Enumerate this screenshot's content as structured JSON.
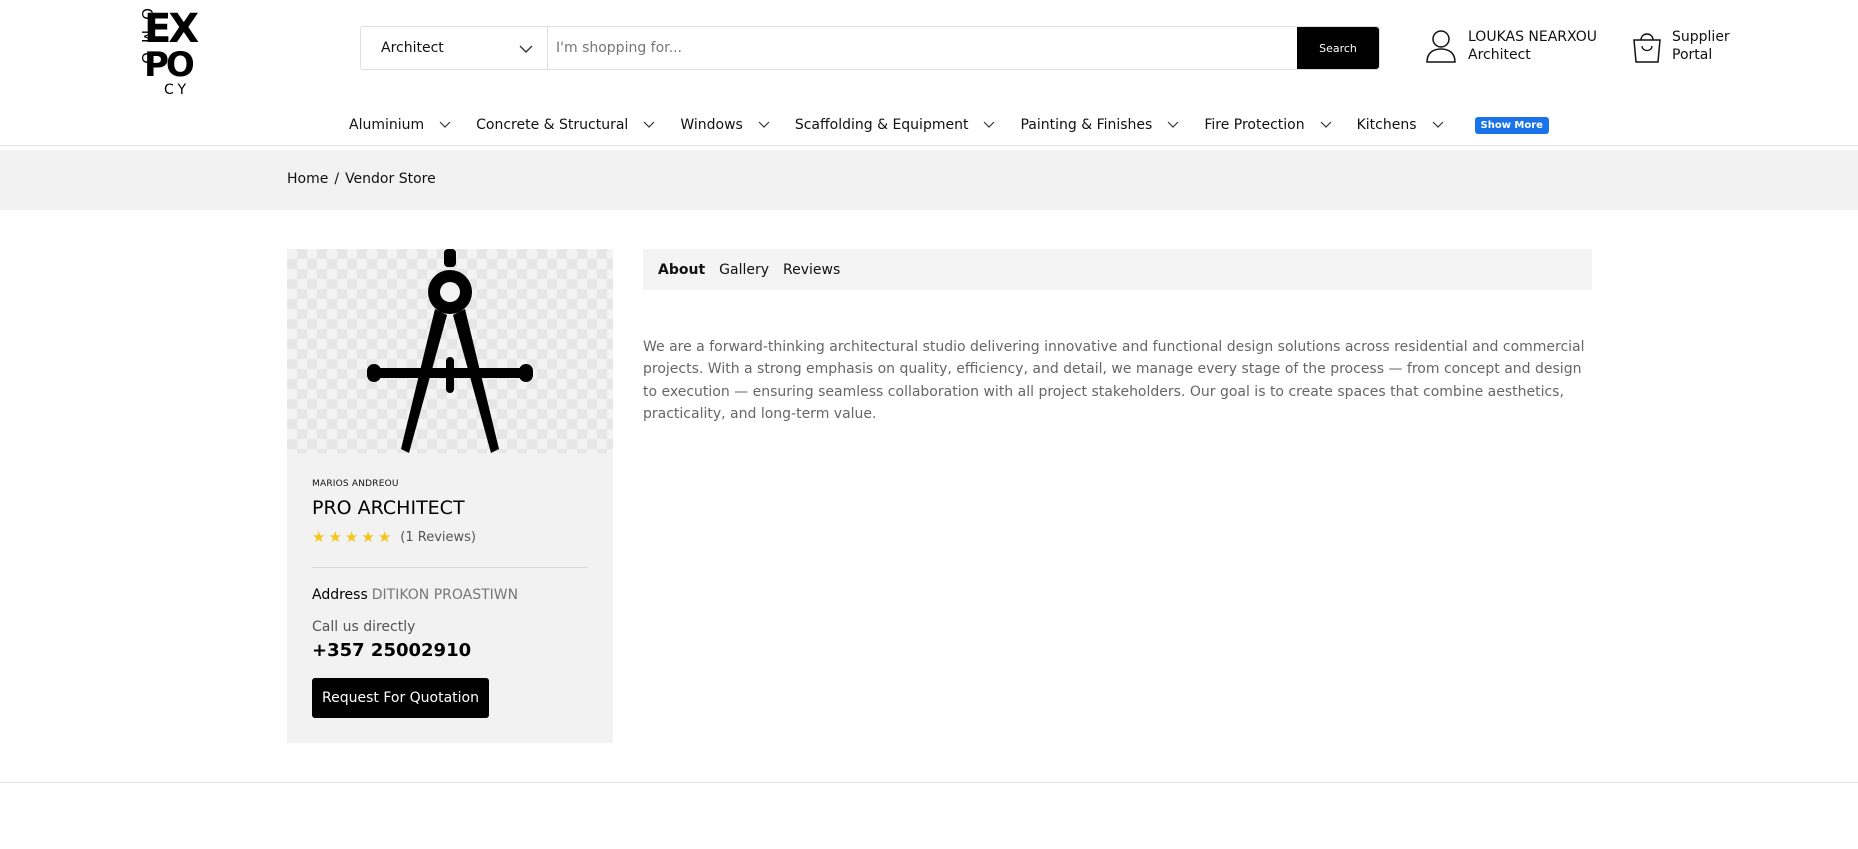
{
  "header": {
    "logo_letters": [
      "O",
      "M",
      "O",
      "EX",
      "PO",
      "CY"
    ],
    "search": {
      "category_value": "Architect",
      "placeholder": "I'm shopping for...",
      "button_label": "Search"
    },
    "account": {
      "name": "LOUKAS NEARXOU",
      "role": "Architect",
      "icon": "user-icon"
    },
    "supplier": {
      "line1": "Supplier",
      "line2": "Portal",
      "icon": "shopping-bag-icon"
    }
  },
  "nav": {
    "items": [
      {
        "label": "Aluminium"
      },
      {
        "label": "Concrete & Structural"
      },
      {
        "label": "Windows"
      },
      {
        "label": "Scaffolding & Equipment"
      },
      {
        "label": "Painting & Finishes"
      },
      {
        "label": "Fire Protection"
      },
      {
        "label": "Kitchens"
      }
    ],
    "show_more": "Show More",
    "show_more_color": "#1a73e8"
  },
  "breadcrumb": {
    "home": "Home",
    "separator": "/",
    "current": "Vendor Store"
  },
  "vendor": {
    "image_icon": "drafting-compass-icon",
    "owner": "MARIOS ANDREOU",
    "store_name": "PRO ARCHITECT",
    "rating_stars": 5,
    "star_color": "#f5c518",
    "reviews": "(1 Reviews)",
    "address_label": "Address",
    "address_value": "DITIKON PROASTIWN",
    "call_label": "Call us directly",
    "phone": "+357 25002910",
    "rfq_label": "Request For Quotation"
  },
  "tabs": [
    {
      "label": "About",
      "active": true
    },
    {
      "label": "Gallery",
      "active": false
    },
    {
      "label": "Reviews",
      "active": false
    }
  ],
  "about": {
    "text": "We are a forward-thinking architectural studio delivering innovative and functional design solutions across residential and commercial projects. With a strong emphasis on quality, efficiency, and detail, we manage every stage of the process — from concept and design to execution — ensuring seamless collaboration with all project stakeholders. Our goal is to create spaces that combine aesthetics, practicality, and long-term value."
  }
}
